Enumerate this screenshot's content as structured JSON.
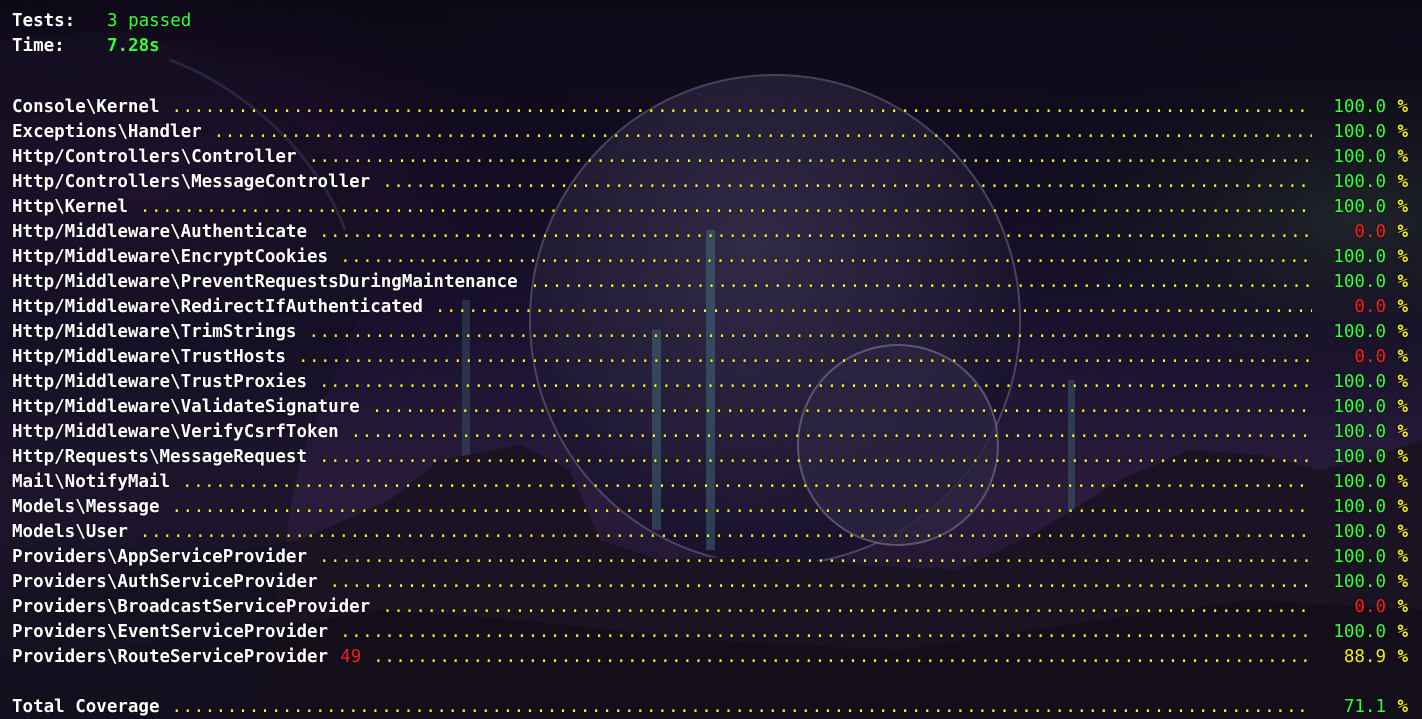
{
  "summary": {
    "tests_label": "Tests:",
    "tests_value": "3 passed",
    "time_label": "Time:",
    "time_value": "7.28s"
  },
  "colors": {
    "name": "#ffffff",
    "dots": "#f5ee1a",
    "full": "#33ff33",
    "zero": "#ff1a1a",
    "partial": "#f5ee1a"
  },
  "files": [
    {
      "name": "Console\\Kernel",
      "uncovered": "",
      "pct": "100.0",
      "status": "green"
    },
    {
      "name": "Exceptions\\Handler",
      "uncovered": "",
      "pct": "100.0",
      "status": "green"
    },
    {
      "name": "Http/Controllers\\Controller",
      "uncovered": "",
      "pct": "100.0",
      "status": "green"
    },
    {
      "name": "Http/Controllers\\MessageController",
      "uncovered": "",
      "pct": "100.0",
      "status": "green"
    },
    {
      "name": "Http\\Kernel",
      "uncovered": "",
      "pct": "100.0",
      "status": "green"
    },
    {
      "name": "Http/Middleware\\Authenticate",
      "uncovered": "",
      "pct": "0.0",
      "status": "red"
    },
    {
      "name": "Http/Middleware\\EncryptCookies",
      "uncovered": "",
      "pct": "100.0",
      "status": "green"
    },
    {
      "name": "Http/Middleware\\PreventRequestsDuringMaintenance",
      "uncovered": "",
      "pct": "100.0",
      "status": "green"
    },
    {
      "name": "Http/Middleware\\RedirectIfAuthenticated",
      "uncovered": "",
      "pct": "0.0",
      "status": "red"
    },
    {
      "name": "Http/Middleware\\TrimStrings",
      "uncovered": "",
      "pct": "100.0",
      "status": "green"
    },
    {
      "name": "Http/Middleware\\TrustHosts",
      "uncovered": "",
      "pct": "0.0",
      "status": "red"
    },
    {
      "name": "Http/Middleware\\TrustProxies",
      "uncovered": "",
      "pct": "100.0",
      "status": "green"
    },
    {
      "name": "Http/Middleware\\ValidateSignature",
      "uncovered": "",
      "pct": "100.0",
      "status": "green"
    },
    {
      "name": "Http/Middleware\\VerifyCsrfToken",
      "uncovered": "",
      "pct": "100.0",
      "status": "green"
    },
    {
      "name": "Http/Requests\\MessageRequest",
      "uncovered": "",
      "pct": "100.0",
      "status": "green"
    },
    {
      "name": "Mail\\NotifyMail",
      "uncovered": "",
      "pct": "100.0",
      "status": "green"
    },
    {
      "name": "Models\\Message",
      "uncovered": "",
      "pct": "100.0",
      "status": "green"
    },
    {
      "name": "Models\\User",
      "uncovered": "",
      "pct": "100.0",
      "status": "green"
    },
    {
      "name": "Providers\\AppServiceProvider",
      "uncovered": "",
      "pct": "100.0",
      "status": "green"
    },
    {
      "name": "Providers\\AuthServiceProvider",
      "uncovered": "",
      "pct": "100.0",
      "status": "green"
    },
    {
      "name": "Providers\\BroadcastServiceProvider",
      "uncovered": "",
      "pct": "0.0",
      "status": "red"
    },
    {
      "name": "Providers\\EventServiceProvider",
      "uncovered": "",
      "pct": "100.0",
      "status": "green"
    },
    {
      "name": "Providers\\RouteServiceProvider",
      "uncovered": "49",
      "pct": "88.9",
      "status": "yellow"
    }
  ],
  "percent_sign": "%",
  "total": {
    "label": "Total Coverage",
    "pct": "71.1",
    "status": "green"
  }
}
